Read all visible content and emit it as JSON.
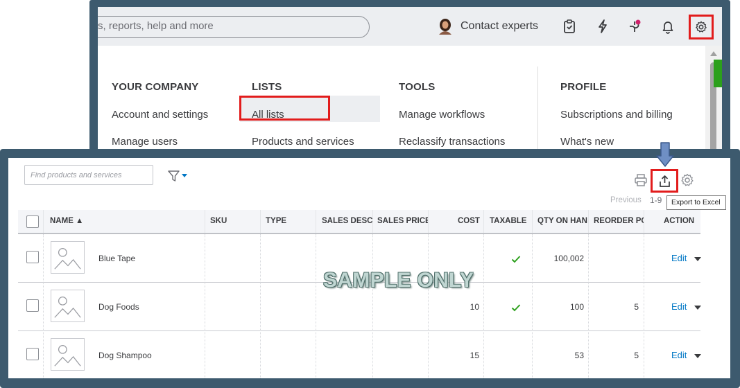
{
  "topbar": {
    "search_text": "s, reports, help and more",
    "contact_experts": "Contact experts"
  },
  "settings_menu": {
    "columns": [
      {
        "heading": "YOUR COMPANY",
        "items": [
          "Account and settings",
          "Manage users"
        ]
      },
      {
        "heading": "LISTS",
        "items": [
          "All lists",
          "Products and services"
        ]
      },
      {
        "heading": "TOOLS",
        "items": [
          "Manage workflows",
          "Reclassify transactions"
        ]
      },
      {
        "heading": "PROFILE",
        "items": [
          "Subscriptions and billing",
          "What's new"
        ]
      }
    ],
    "highlighted_item": "All lists"
  },
  "products": {
    "search_placeholder": "Find products and services",
    "pagination_previous": "Previous",
    "pagination_range": "1-9",
    "export_tooltip": "Export to Excel",
    "columns": [
      "NAME ▲",
      "SKU",
      "TYPE",
      "SALES DESCR",
      "SALES PRICE",
      "COST",
      "TAXABLE",
      "QTY ON HAN",
      "REORDER PO",
      "ACTION"
    ],
    "rows": [
      {
        "name": "Blue Tape",
        "sku": "",
        "type": "",
        "sales_desc": "",
        "sales_price": "",
        "cost": "",
        "taxable": true,
        "qty": "100,002",
        "reorder": "",
        "action": "Edit"
      },
      {
        "name": "Dog Foods",
        "sku": "",
        "type": "",
        "sales_desc": "",
        "sales_price": "",
        "cost": "10",
        "taxable": true,
        "qty": "100",
        "reorder": "5",
        "action": "Edit"
      },
      {
        "name": "Dog Shampoo",
        "sku": "",
        "type": "",
        "sales_desc": "",
        "sales_price": "",
        "cost": "15",
        "taxable": false,
        "qty": "53",
        "reorder": "5",
        "action": "Edit"
      }
    ]
  },
  "watermark": "SAMPLE ONLY",
  "colors": {
    "highlight_red": "#e21c1c",
    "link_blue": "#0077c5",
    "check_green": "#2ca01c",
    "frame": "#3d5a6e"
  },
  "icons": [
    "clipboard-icon",
    "bolt-icon",
    "apps-icon",
    "bell-icon",
    "gear-icon",
    "filter-icon",
    "print-icon",
    "export-icon",
    "settings-icon",
    "check-icon",
    "image-placeholder-icon",
    "arrow-down-icon"
  ]
}
